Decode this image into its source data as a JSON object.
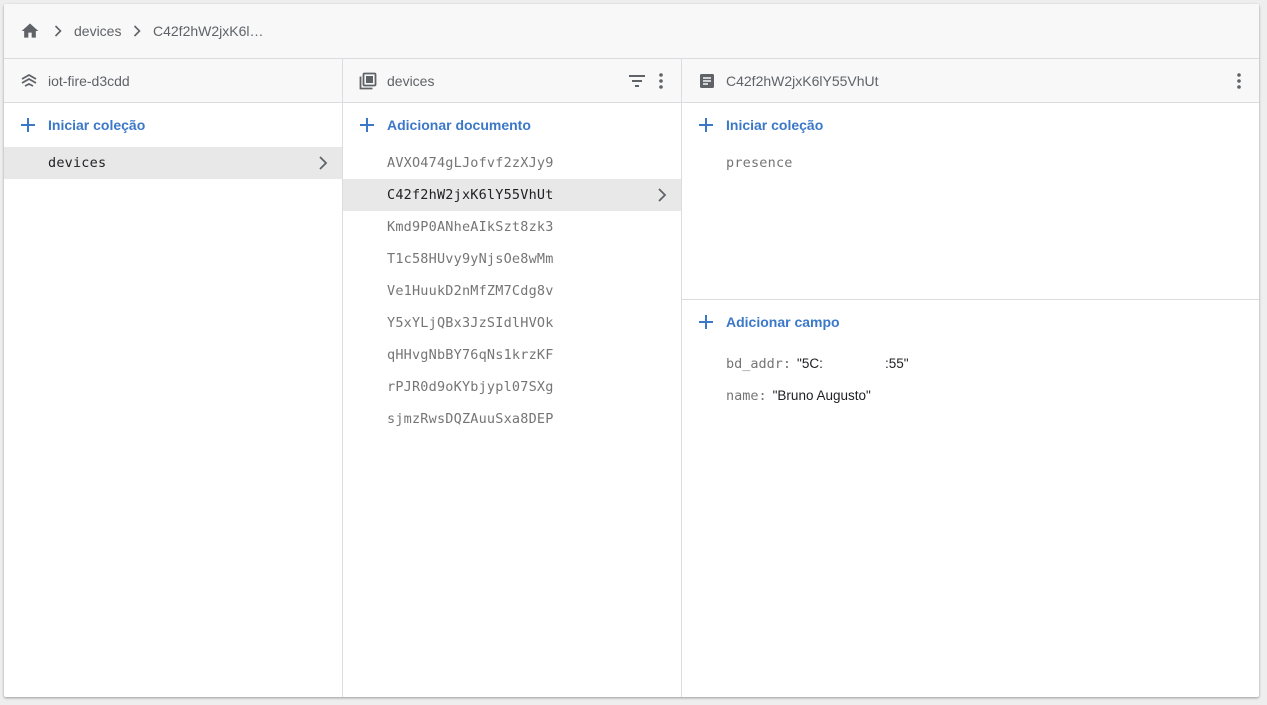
{
  "breadcrumb": {
    "items": [
      "devices",
      "C42f2hW2jxK6l…"
    ]
  },
  "project": {
    "title": "iot-fire-d3cdd",
    "add_label": "Iniciar coleção",
    "collections": [
      "devices"
    ]
  },
  "collection": {
    "title": "devices",
    "add_label": "Adicionar documento",
    "documents": [
      "AVXO474gLJofvf2zXJy9",
      "C42f2hW2jxK6lY55VhUt",
      "Kmd9P0ANheAIkSzt8zk3",
      "T1c58HUvy9yNjsOe8wMm",
      "Ve1HuukD2nMfZM7Cdg8v",
      "Y5xYLjQBx3JzSIdlHVOk",
      "qHHvgNbBY76qNs1krzKF",
      "rPJR0d9oKYbjypl07SXg",
      "sjmzRwsDQZAuuSxa8DEP"
    ],
    "selected_index": 1
  },
  "document": {
    "title": "C42f2hW2jxK6lY55VhUt",
    "add_collection_label": "Iniciar coleção",
    "subcollections": [
      "presence"
    ],
    "add_field_label": "Adicionar campo",
    "fields": [
      {
        "key": "bd_addr:",
        "value": "\"5C:                       :55\""
      },
      {
        "key": "name:",
        "value": "\"Bruno Augusto\""
      }
    ]
  },
  "colors": {
    "accent": "#3b78c8",
    "header_bg": "#f8f8f8",
    "selected_bg": "#e8e8e8"
  }
}
